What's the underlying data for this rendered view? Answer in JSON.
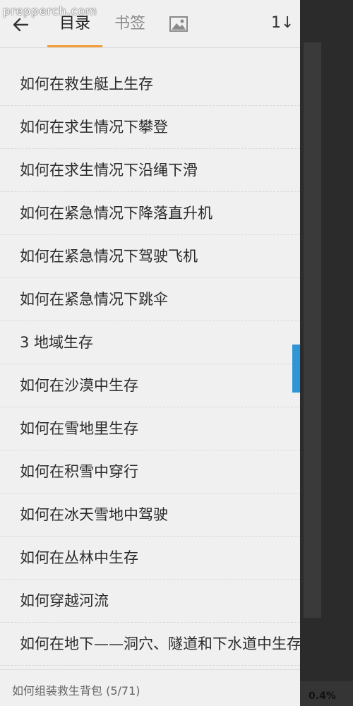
{
  "watermark": "prepperch.com",
  "header": {
    "tab_toc": "目录",
    "tab_bookmark": "书签",
    "sort_label": "1↓"
  },
  "toc": {
    "items": [
      {
        "label": "如何在救生艇上生存"
      },
      {
        "label": "如何在求生情况下攀登"
      },
      {
        "label": "如何在求生情况下沿绳下滑"
      },
      {
        "label": "如何在紧急情况下降落直升机"
      },
      {
        "label": "如何在紧急情况下驾驶飞机"
      },
      {
        "label": "如何在紧急情况下跳伞"
      },
      {
        "label": "3 地域生存"
      },
      {
        "label": "如何在沙漠中生存"
      },
      {
        "label": "如何在雪地里生存"
      },
      {
        "label": "如何在积雪中穿行"
      },
      {
        "label": "如何在冰天雪地中驾驶"
      },
      {
        "label": "如何在丛林中生存"
      },
      {
        "label": "如何穿越河流"
      },
      {
        "label": "如何在地下——洞穴、隧道和下水道中生存"
      }
    ]
  },
  "footer": {
    "current_chapter": "如何组装救生背包 (5/71)"
  },
  "reader": {
    "progress": "0.4%"
  },
  "colors": {
    "accent": "#f39c38",
    "scroll_thumb": "#2f95d6"
  }
}
